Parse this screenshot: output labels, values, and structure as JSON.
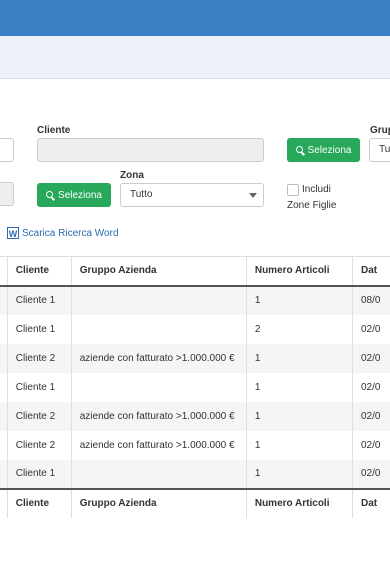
{
  "form": {
    "cliente_label": "Cliente",
    "seleziona_label": "Seleziona",
    "gruppo_label_partial": "Grup",
    "gruppo_value_partial": "Tu",
    "zona_label": "Zona",
    "zona_value": "Tutto",
    "includi_label": "Includi",
    "zone_figlie_label": "Zone Figlie",
    "download_word_label": "Scarica Ricerca Word",
    "word_icon_letter": "W"
  },
  "table": {
    "headers": [
      "Cliente",
      "Gruppo Azienda",
      "Numero Articoli",
      "Dat"
    ],
    "rows": [
      {
        "cliente": "Cliente 1",
        "gruppo": "",
        "numero": "1",
        "data": "08/0"
      },
      {
        "cliente": "Cliente 1",
        "gruppo": "",
        "numero": "2",
        "data": "02/0"
      },
      {
        "cliente": "Cliente 2",
        "gruppo": "aziende con fatturato >1.000.000 €",
        "numero": "1",
        "data": "02/0"
      },
      {
        "cliente": "Cliente 1",
        "gruppo": "",
        "numero": "1",
        "data": "02/0"
      },
      {
        "cliente": "Cliente 2",
        "gruppo": "aziende con fatturato >1.000.000 €",
        "numero": "1",
        "data": "02/0"
      },
      {
        "cliente": "Cliente 2",
        "gruppo": "aziende con fatturato >1.000.000 €",
        "numero": "1",
        "data": "02/0"
      },
      {
        "cliente": "Cliente 1",
        "gruppo": "",
        "numero": "1",
        "data": "02/0"
      }
    ]
  },
  "colors": {
    "topbar": "#3b7fc4",
    "button_green": "#28a85a",
    "link_blue": "#2b6cb0"
  }
}
